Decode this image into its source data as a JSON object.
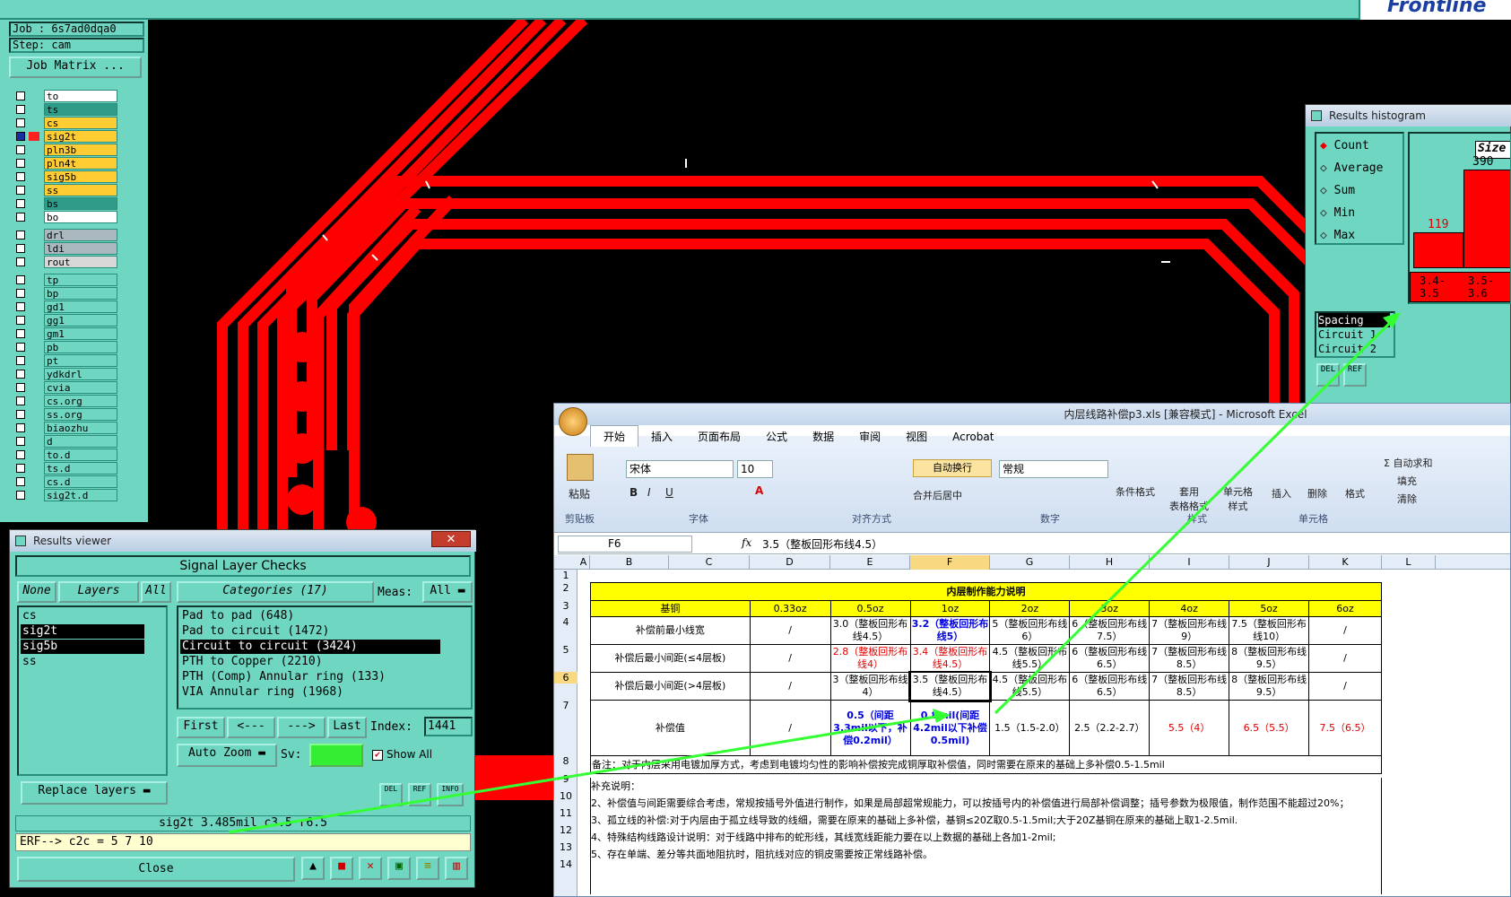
{
  "left_panel": {
    "job": "Job : 6s7ad0dqa0",
    "step": "Step: cam",
    "job_matrix_button": "Job Matrix ...",
    "layers": [
      {
        "name": "to",
        "color": "#ffffff"
      },
      {
        "name": "ts",
        "color": "#2f9c8a"
      },
      {
        "name": "cs",
        "color": "#ffcc33"
      },
      {
        "name": "sig2t",
        "color": "#ffcc33"
      },
      {
        "name": "pln3b",
        "color": "#ffcc33"
      },
      {
        "name": "pln4t",
        "color": "#ffcc33"
      },
      {
        "name": "sig5b",
        "color": "#ffcc33"
      },
      {
        "name": "ss",
        "color": "#ffcc33"
      },
      {
        "name": "bs",
        "color": "#2f9c8a"
      },
      {
        "name": "bo",
        "color": "#ffffff"
      },
      {
        "name": "drl",
        "color": "#aab8c0"
      },
      {
        "name": "ldi",
        "color": "#aab8c0"
      },
      {
        "name": "rout",
        "color": "#d8d8d8"
      },
      {
        "name": "tp",
        "color": "#6fd6c2"
      },
      {
        "name": "bp",
        "color": "#6fd6c2"
      },
      {
        "name": "gd1",
        "color": "#6fd6c2"
      },
      {
        "name": "gg1",
        "color": "#6fd6c2"
      },
      {
        "name": "gm1",
        "color": "#6fd6c2"
      },
      {
        "name": "pb",
        "color": "#6fd6c2"
      },
      {
        "name": "pt",
        "color": "#6fd6c2"
      },
      {
        "name": "ydkdrl",
        "color": "#6fd6c2"
      },
      {
        "name": "cvia",
        "color": "#6fd6c2"
      },
      {
        "name": "cs.org",
        "color": "#6fd6c2"
      },
      {
        "name": "ss.org",
        "color": "#6fd6c2"
      },
      {
        "name": "biaozhu",
        "color": "#6fd6c2"
      },
      {
        "name": "d",
        "color": "#6fd6c2"
      },
      {
        "name": "to.d",
        "color": "#6fd6c2"
      },
      {
        "name": "ts.d",
        "color": "#6fd6c2"
      },
      {
        "name": "cs.d",
        "color": "#6fd6c2"
      },
      {
        "name": "sig2t.d",
        "color": "#6fd6c2"
      }
    ]
  },
  "histogram": {
    "title": "Results histogram",
    "options": [
      "Count",
      "Average",
      "Sum",
      "Min",
      "Max"
    ],
    "selected": "Count",
    "size_label": "Size",
    "bar_values": [
      "119",
      "390"
    ],
    "bar_ranges": [
      "3.4-\n3.5",
      "3.5-\n3.6"
    ],
    "legend": [
      "Spacing",
      "Circuit 1",
      "Circuit 2"
    ],
    "btn_del": "DEL",
    "btn_ref": "REF"
  },
  "results_viewer": {
    "title": "Results viewer",
    "heading": "Signal Layer Checks",
    "none_btn": "None",
    "layers_btn": "Layers",
    "all_btn": "All",
    "categories_btn": "Categories (17)",
    "meas_label": "Meas:",
    "meas_value": "All",
    "layers": [
      "cs",
      "sig2t",
      "sig5b",
      "ss"
    ],
    "categories": [
      "Pad to pad (648)",
      "Pad to circuit (1472)",
      "Circuit to circuit (3424)",
      "PTH to Copper (2210)",
      "PTH (Comp) Annular ring (133)",
      "VIA Annular ring (1968)"
    ],
    "selected_category": "Circuit to circuit (3424)",
    "first_btn": "First",
    "prev_btn": "<---",
    "next_btn": "--->",
    "last_btn": "Last",
    "index_label": "Index:",
    "index_value": "1441",
    "auto_zoom": "Auto Zoom",
    "sv_label": "Sv:",
    "show_all": "Show All",
    "replace_layers": "Replace layers",
    "del_btn": "DEL",
    "ref_btn": "REF",
    "info_btn": "INFO",
    "status": "sig2t 3.485mil   c3.5   r6.5",
    "erf_line": "ERF--> c2c = 5 7 10",
    "close_btn": "Close"
  },
  "excel": {
    "title": "内层线路补偿p3.xls  [兼容模式] - Microsoft Excel",
    "tabs": [
      "开始",
      "插入",
      "页面布局",
      "公式",
      "数据",
      "审阅",
      "视图",
      "Acrobat"
    ],
    "font_name": "宋体",
    "font_size": "10",
    "number_format": "常规",
    "ribbon_labels": {
      "paste": "粘贴",
      "clipboard": "剪贴板",
      "font": "字体",
      "align": "对齐方式",
      "number": "数字",
      "wrap": "自动换行",
      "merge": "合并后居中",
      "cond": "条件格式",
      "table": "套用\n表格格式",
      "cellstyle": "单元格\n样式",
      "styles": "样式",
      "insert": "插入",
      "delete": "删除",
      "format": "格式",
      "cells": "单元格",
      "autosum": "Σ 自动求和",
      "fill": "填充",
      "clear": "清除"
    },
    "cell_ref": "F6",
    "fx": "fx",
    "formula": "3.5（整板回形布线4.5）",
    "col_headers": [
      "A",
      "B",
      "C",
      "D",
      "E",
      "F",
      "G",
      "H",
      "I",
      "J",
      "K",
      "L"
    ],
    "row_numbers": [
      "1",
      "2",
      "3",
      "4",
      "5",
      "6",
      "7",
      "8",
      "9",
      "10",
      "11",
      "12",
      "13",
      "14"
    ],
    "table_title": "内层制作能力说明",
    "header_row": [
      "基铜",
      "0.33oz",
      "0.5oz",
      "1oz",
      "2oz",
      "3oz",
      "4oz",
      "5oz",
      "6oz"
    ],
    "rows": [
      [
        "补偿前最小线宽",
        "/",
        "3.0（整板回形布线4.5）",
        "3.2（整板回形布线5）",
        "5（整板回形布线6）",
        "6（整板回形布线7.5）",
        "7（整板回形布线9）",
        "7.5（整板回形布线10）",
        "/"
      ],
      [
        "补偿后最小间距(≤4层板)",
        "/",
        "2.8（整板回形布线4）",
        "3.4（整板回形布线4.5）",
        "4.5（整板回形布线5.5）",
        "6（整板回形布线6.5）",
        "7（整板回形布线8.5）",
        "8（整板回形布线9.5）",
        "/"
      ],
      [
        "补偿后最小间距(>4层板)",
        "/",
        "3（整板回形布线4）",
        "3.5（整板回形布线4.5）",
        "4.5（整板回形布线5.5）",
        "6（整板回形布线6.5）",
        "7（整板回形布线8.5）",
        "8（整板回形布线9.5）",
        "/"
      ],
      [
        "补偿值",
        "/",
        "0.5（间距3.3mil以下，补偿0.2mil）",
        "0.8mil(间距4.2mil以下补偿0.5mil)",
        "1.5（1.5-2.0）",
        "2.5（2.2-2.7）",
        "5.5（4）",
        "6.5（5.5）",
        "7.5（6.5）"
      ]
    ],
    "note": "备注：对于内层采用电镀加厚方式，考虑到电镀均匀性的影响补偿按完成铜厚取补偿值，同时需要在原来的基础上多补偿0.5-1.5mil",
    "supplement_title": "补充说明：",
    "supplements": [
      "2、补偿值与间距需要综合考虑，常规按插号外值进行制作，如果是局部超常规能力，可以按插号内的补偿值进行局部补偿调整；插号参数为极限值，制作范围不能超过20%；",
      "3、孤立线的补偿:对于内层由于孤立线导致的线细，需要在原来的基础上多补偿，基铜≤20Z取0.5-1.5mil;大于20Z基铜在原来的基础上取1-2.5mil.",
      "4、特殊结构线路设计说明：对于线路中排布的蛇形线，其线宽线距能力要在以上数据的基础上各加1-2mil;",
      "5、存在单端、差分等共面地阻抗时，阻抗线对应的铜皮需要按正常线路补偿。"
    ]
  }
}
